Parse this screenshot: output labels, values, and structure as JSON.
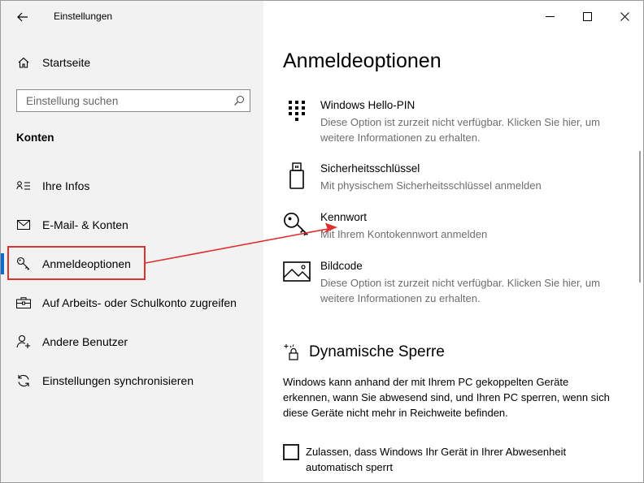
{
  "window": {
    "app_title": "Einstellungen"
  },
  "sidebar": {
    "home_label": "Startseite",
    "search_placeholder": "Einstellung suchen",
    "section_title": "Konten",
    "items": [
      {
        "label": "Ihre Infos",
        "icon": "person-card-icon"
      },
      {
        "label": "E-Mail- & Konten",
        "icon": "mail-icon"
      },
      {
        "label": "Anmeldeoptionen",
        "icon": "key-icon"
      },
      {
        "label": "Auf Arbeits- oder Schulkonto zugreifen",
        "icon": "briefcase-icon"
      },
      {
        "label": "Andere Benutzer",
        "icon": "person-add-icon"
      },
      {
        "label": "Einstellungen synchronisieren",
        "icon": "sync-icon"
      }
    ],
    "active_index": 2
  },
  "main": {
    "title": "Anmeldeoptionen",
    "options": [
      {
        "title": "Windows Hello-PIN",
        "description": "Diese Option ist zurzeit nicht verfügbar. Klicken Sie hier, um weitere Informationen zu erhalten.",
        "icon": "keypad-icon"
      },
      {
        "title": "Sicherheitsschlüssel",
        "description": "Mit physischem Sicherheitsschlüssel anmelden",
        "icon": "usb-key-icon"
      },
      {
        "title": "Kennwort",
        "description": "Mit Ihrem Kontokennwort anmelden",
        "icon": "password-key-icon"
      },
      {
        "title": "Bildcode",
        "description": "Diese Option ist zurzeit nicht verfügbar. Klicken Sie hier, um weitere Informationen zu erhalten.",
        "icon": "picture-icon"
      }
    ],
    "dynamic_lock": {
      "title": "Dynamische Sperre",
      "description": "Windows kann anhand der mit Ihrem PC gekoppelten Geräte erkennen, wann Sie abwesend sind, und Ihren PC sperren, wenn sich diese Geräte nicht mehr in Reichweite befinden.",
      "checkbox_label": "Zulassen, dass Windows Ihr Gerät in Ihrer Abwesenheit automatisch sperrt",
      "checked": false
    }
  },
  "colors": {
    "accent": "#0a6bd3",
    "annotation": "#e03131",
    "sidebar_bg": "#f2f2f2",
    "desc_text": "#6d6d6d"
  }
}
